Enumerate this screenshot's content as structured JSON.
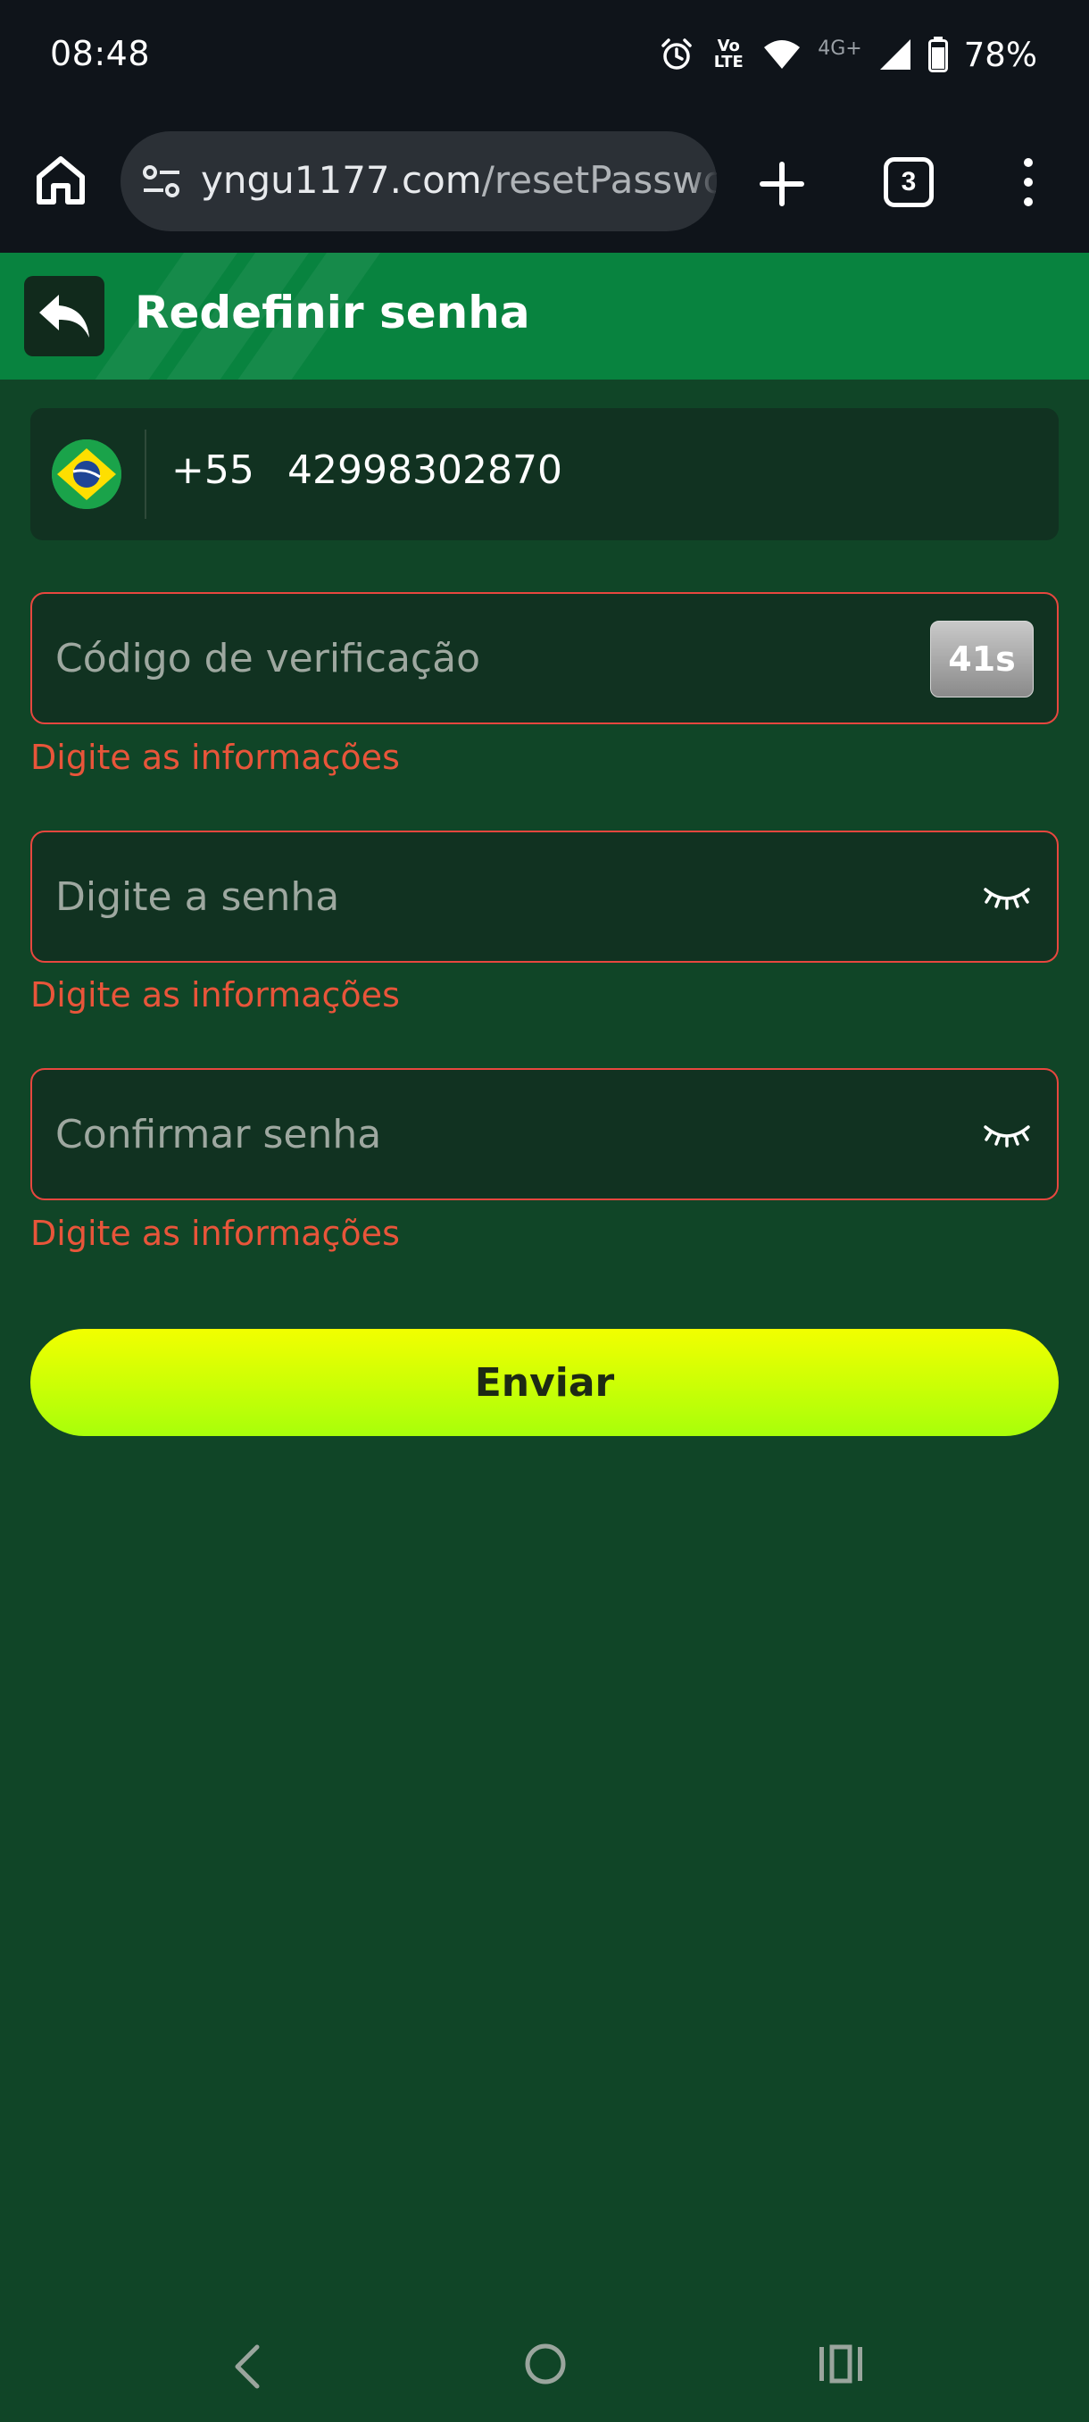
{
  "status_bar": {
    "time": "08:48",
    "volte_label": "Vo LTE",
    "network_label": "4G+",
    "battery": "78%",
    "icons": [
      "alarm-icon",
      "volte-icon",
      "wifi-icon",
      "signal-icon",
      "battery-icon"
    ]
  },
  "browser": {
    "url_host": "yngu1177.com",
    "url_path": "/resetPasswor",
    "tab_count": "3",
    "icons": [
      "home-icon",
      "site-settings-icon",
      "new-tab-icon",
      "tab-switcher-icon",
      "more-menu-icon"
    ]
  },
  "header": {
    "title": "Redefinir senha",
    "back_icon": "reply-arrow-icon",
    "background": "#08833f"
  },
  "form": {
    "country_flag": "brazil-flag-icon",
    "dial_code": "+55",
    "phone_number": "42998302870",
    "code_placeholder": "Código de verificação",
    "code_timer": "41s",
    "code_error": "Digite as informações",
    "password_placeholder": "Digite a senha",
    "password_error": "Digite as informações",
    "confirm_placeholder": "Confirmar senha",
    "confirm_error": "Digite as informações",
    "submit_label": "Enviar"
  },
  "colors": {
    "page_background": "#104527",
    "field_background": "#113221",
    "error": "#e8553a",
    "submit_gradient": [
      "#f2ff00",
      "#a8ff0a"
    ]
  },
  "nav_bar": {
    "icons": [
      "nav-back-icon",
      "nav-home-icon",
      "nav-recents-icon"
    ]
  }
}
